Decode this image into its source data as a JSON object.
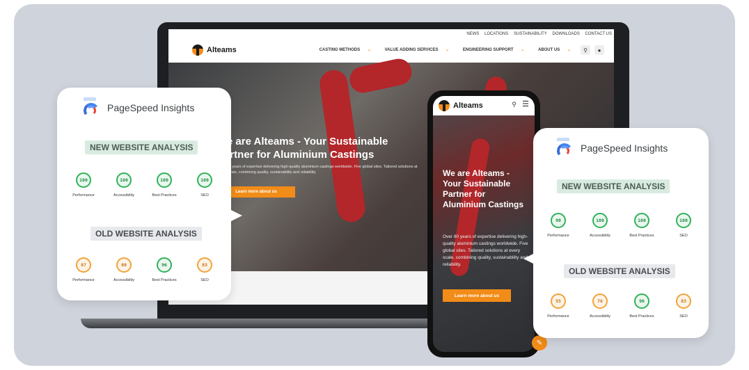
{
  "laptop": {
    "topbar_links": [
      "NEWS",
      "LOCATIONS",
      "SUSTAINABILITY",
      "DOWNLOADS",
      "CONTACT US"
    ],
    "brand": "Alteams",
    "nav_items": [
      "CASTING METHODS",
      "VALUE ADDING SERVICES",
      "ENGINEERING SUPPORT",
      "ABOUT US"
    ],
    "hero_title": "We are Alteams - Your Sustainable Partner for Aluminium Castings",
    "hero_sub": "Over 80 years of expertise delivering high-quality aluminium castings worldwide. Five global sites. Tailored solutions at every scale, combining quality, sustainability and reliability.",
    "hero_button": "Learn more about us"
  },
  "phone": {
    "brand": "Alteams",
    "hero_title": "We are Alteams - Your Sustainable Partner for Aluminium Castings",
    "hero_sub": "Over 80 years of expertise delivering high-quality aluminium castings worldwide. Five global sites. Tailored solutions at every scale, combining quality, sustainability and reliability.",
    "hero_button": "Learn more about us"
  },
  "card_left": {
    "title": "PageSpeed Insights",
    "new_label": "NEW WEBSITE ANALYSIS",
    "old_label": "OLD WEBSITE ANALYSIS",
    "new_metrics": [
      {
        "score": "100",
        "label": "Performance",
        "status": "good"
      },
      {
        "score": "100",
        "label": "Accessibility",
        "status": "good"
      },
      {
        "score": "100",
        "label": "Best Practices",
        "status": "good"
      },
      {
        "score": "100",
        "label": "SEO",
        "status": "good"
      }
    ],
    "old_metrics": [
      {
        "score": "87",
        "label": "Performance",
        "status": "average"
      },
      {
        "score": "80",
        "label": "Accessibility",
        "status": "average"
      },
      {
        "score": "96",
        "label": "Best Practices",
        "status": "good"
      },
      {
        "score": "83",
        "label": "SEO",
        "status": "average"
      }
    ]
  },
  "card_right": {
    "title": "PageSpeed Insights",
    "new_label": "NEW WEBSITE ANALYSIS",
    "old_label": "OLD WEBSITE ANALYSIS",
    "new_metrics": [
      {
        "score": "90",
        "label": "Performance",
        "status": "good"
      },
      {
        "score": "100",
        "label": "Accessibility",
        "status": "good"
      },
      {
        "score": "100",
        "label": "Best Practices",
        "status": "good"
      },
      {
        "score": "100",
        "label": "SEO",
        "status": "good"
      }
    ],
    "old_metrics": [
      {
        "score": "55",
        "label": "Performance",
        "status": "average"
      },
      {
        "score": "76",
        "label": "Accessibility",
        "status": "average"
      },
      {
        "score": "96",
        "label": "Best Practices",
        "status": "good"
      },
      {
        "score": "83",
        "label": "SEO",
        "status": "average"
      }
    ]
  },
  "colors": {
    "brand_orange": "#f28c18",
    "good_green": "#2fb25a",
    "average_orange": "#f2a33a",
    "new_label_bg": "#d9ebe0"
  }
}
